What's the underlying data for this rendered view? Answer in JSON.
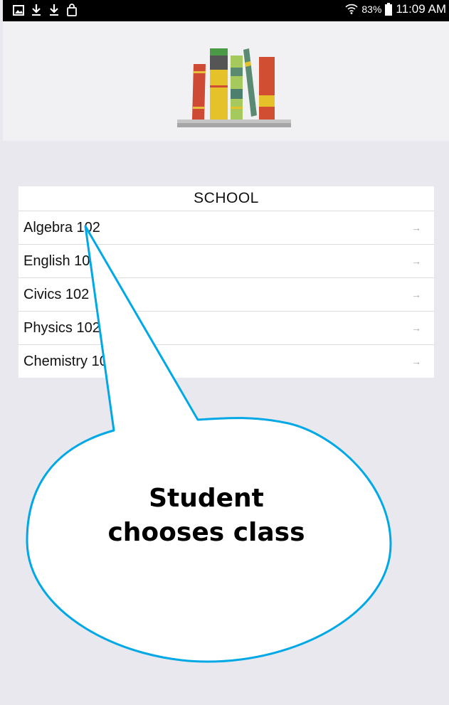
{
  "status_bar": {
    "icons": [
      "gallery-icon",
      "download-icon",
      "download-icon",
      "shopping-bag-icon",
      "wifi-icon",
      "battery-icon"
    ],
    "battery_percent": "83%",
    "time": "11:09 AM"
  },
  "header": {
    "logo": "bookshelf-icon"
  },
  "class_list": {
    "title": "SCHOOL",
    "items": [
      {
        "label": "Algebra 102",
        "icon": "arrow-right-icon"
      },
      {
        "label": "English 102",
        "icon": "arrow-right-icon"
      },
      {
        "label": "Civics 102",
        "icon": "arrow-right-icon"
      },
      {
        "label": "Physics 102",
        "icon": "arrow-right-icon"
      },
      {
        "label": "Chemistry 102",
        "icon": "arrow-right-icon"
      }
    ]
  },
  "callout": {
    "text_line1": "Student",
    "text_line2": "chooses class",
    "border_color": "#00a8e6"
  },
  "colors": {
    "background": "#e9e8ee",
    "header": "#f1f1f3",
    "callout_border": "#00a8e6"
  }
}
